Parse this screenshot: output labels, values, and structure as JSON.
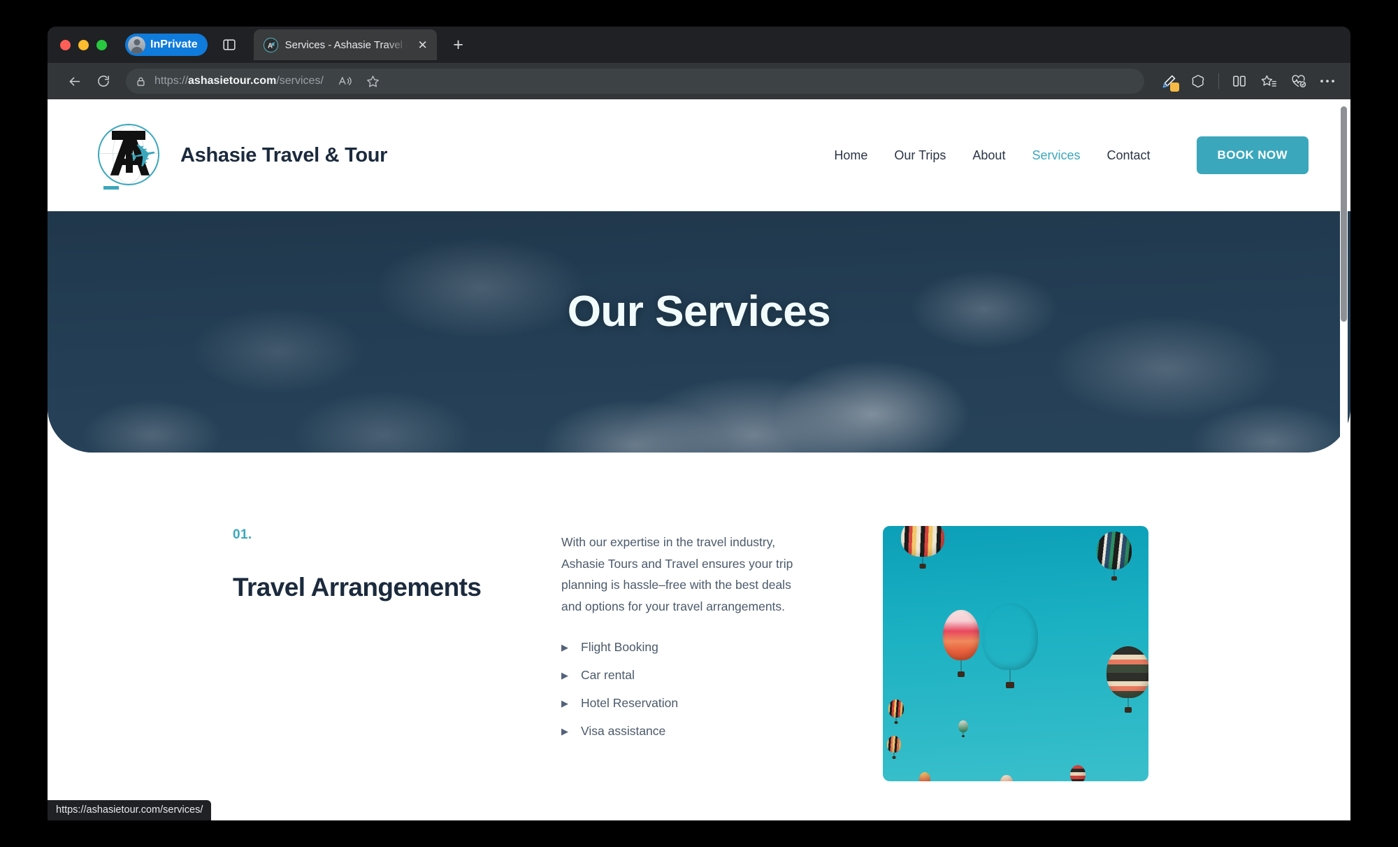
{
  "browser": {
    "window_controls": [
      "close",
      "minimize",
      "maximize"
    ],
    "profile_pill_label": "InPrivate",
    "tab_list_icon": "tab-list-icon",
    "tab": {
      "title": "Services - Ashasie Travel & Tou",
      "favicon": "ashasie-favicon",
      "close_icon": "close-icon"
    },
    "new_tab_icon": "plus-icon",
    "back_icon": "back-arrow-icon",
    "reload_icon": "reload-icon",
    "omnibox": {
      "lock_icon": "lock-icon",
      "url_scheme": "https://",
      "url_domain": "ashasietour.com",
      "url_path": "/services/",
      "read_aloud_icon": "read-aloud-icon",
      "favorite_icon": "star-outline-icon"
    },
    "toolbar_icons": [
      "highlighter-pen-icon",
      "copilot-icon",
      "split-screen-icon",
      "collections-icon",
      "browser-essentials-icon",
      "settings-and-more-icon"
    ],
    "status_bubble_url": "https://ashasietour.com/services/"
  },
  "site": {
    "brand_name": "Ashasie Travel & Tour",
    "logo_letter": "A",
    "logo_plane_icon": "airplane-icon",
    "nav": [
      {
        "label": "Home",
        "active": false
      },
      {
        "label": "Our Trips",
        "active": false
      },
      {
        "label": "About",
        "active": false
      },
      {
        "label": "Services",
        "active": true
      },
      {
        "label": "Contact",
        "active": false
      }
    ],
    "cta_label": "BOOK NOW",
    "hero_title": "Our Services",
    "service": {
      "number": "01.",
      "heading": "Travel Arrangements",
      "description": "With our expertise in the travel industry, Ashasie Tours and Travel ensures your trip planning is hassle–free with the best deals and options for your travel arrangements.",
      "items": [
        "Flight Booking",
        "Car rental",
        "Hotel Reservation",
        "Visa assistance"
      ],
      "image_alt": "hot-air-balloons-photo"
    }
  },
  "colors": {
    "accent_teal": "#3ba7bc",
    "hero_navy": "#274156",
    "heading_navy": "#1b2a3d",
    "body_gray": "#4b5a6b",
    "inprivate_blue": "#0f7bdb",
    "balloon_sky": "#1ab0c2"
  }
}
